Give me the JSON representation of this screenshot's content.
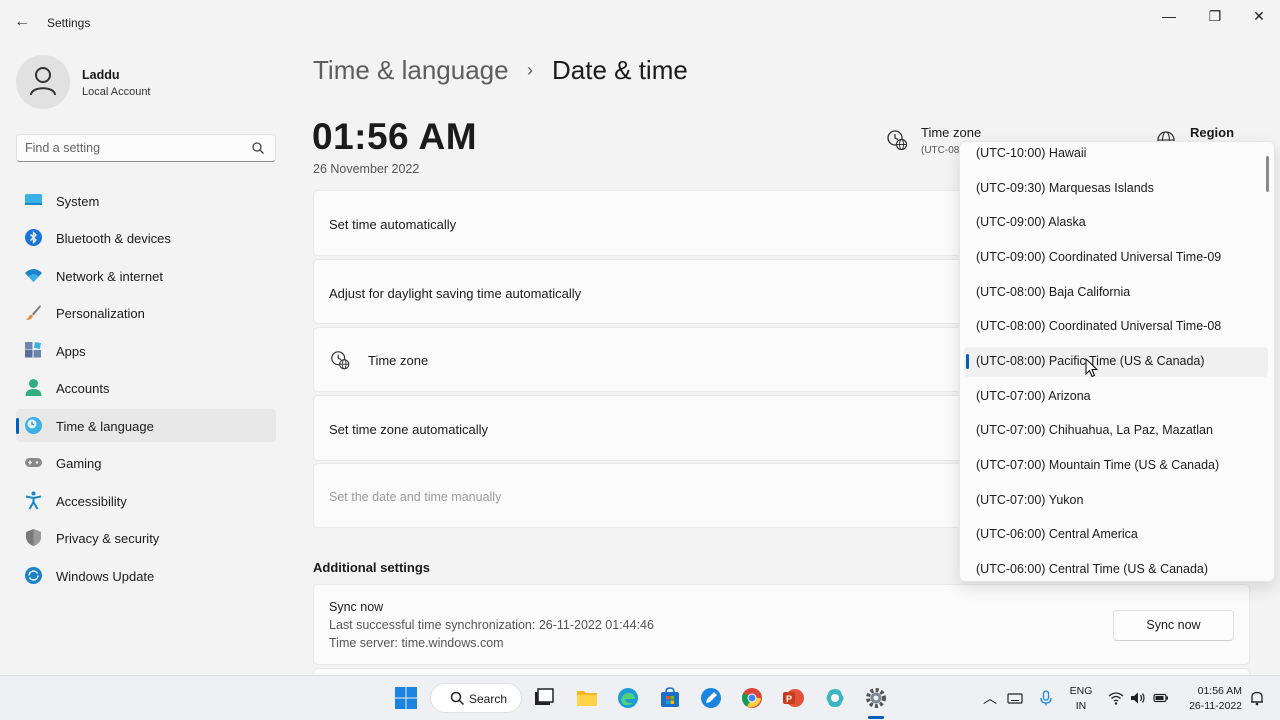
{
  "window": {
    "title": "Settings"
  },
  "user": {
    "name": "Laddu",
    "account_type": "Local Account"
  },
  "search": {
    "placeholder": "Find a setting"
  },
  "sidebar": {
    "items": [
      {
        "label": "System",
        "icon": "monitor-icon"
      },
      {
        "label": "Bluetooth & devices",
        "icon": "bluetooth-icon"
      },
      {
        "label": "Network & internet",
        "icon": "wifi-icon"
      },
      {
        "label": "Personalization",
        "icon": "brush-icon"
      },
      {
        "label": "Apps",
        "icon": "apps-icon"
      },
      {
        "label": "Accounts",
        "icon": "person-icon"
      },
      {
        "label": "Time & language",
        "icon": "clock-globe-icon",
        "active": true
      },
      {
        "label": "Gaming",
        "icon": "gamepad-icon"
      },
      {
        "label": "Accessibility",
        "icon": "accessibility-icon"
      },
      {
        "label": "Privacy & security",
        "icon": "shield-icon"
      },
      {
        "label": "Windows Update",
        "icon": "update-icon"
      }
    ]
  },
  "breadcrumb": {
    "parent": "Time & language",
    "separator": "›",
    "current": "Date & time"
  },
  "clock": {
    "time": "01:56 AM",
    "date": "26 November 2022"
  },
  "header_info": {
    "timezone_label": "Time zone",
    "timezone_value": "(UTC-08",
    "region_label": "Region"
  },
  "settings": {
    "set_time_auto": "Set time automatically",
    "daylight_saving": "Adjust for daylight saving time automatically",
    "time_zone": "Time zone",
    "set_tz_auto": "Set time zone automatically",
    "set_manually": "Set the date and time manually"
  },
  "additional": {
    "title": "Additional settings",
    "sync_title": "Sync now",
    "last_sync": "Last successful time synchronization: 26-11-2022 01:44:46",
    "time_server": "Time server: time.windows.com",
    "sync_button": "Sync now"
  },
  "timezone_dropdown": {
    "options": [
      "(UTC-10:00) Hawaii",
      "(UTC-09:30) Marquesas Islands",
      "(UTC-09:00) Alaska",
      "(UTC-09:00) Coordinated Universal Time-09",
      "(UTC-08:00) Baja California",
      "(UTC-08:00) Coordinated Universal Time-08",
      "(UTC-08:00) Pacific Time (US & Canada)",
      "(UTC-07:00) Arizona",
      "(UTC-07:00) Chihuahua, La Paz, Mazatlan",
      "(UTC-07:00) Mountain Time (US & Canada)",
      "(UTC-07:00) Yukon",
      "(UTC-06:00) Central America",
      "(UTC-06:00) Central Time (US & Canada)"
    ],
    "selected": "(UTC-08:00) Pacific Time (US & Canada)"
  },
  "taskbar": {
    "search_label": "Search",
    "language": "ENG",
    "region": "IN",
    "time": "01:56 AM",
    "date": "26-11-2022"
  },
  "colors": {
    "accent": "#005fb8",
    "background": "#f3f3f3"
  }
}
